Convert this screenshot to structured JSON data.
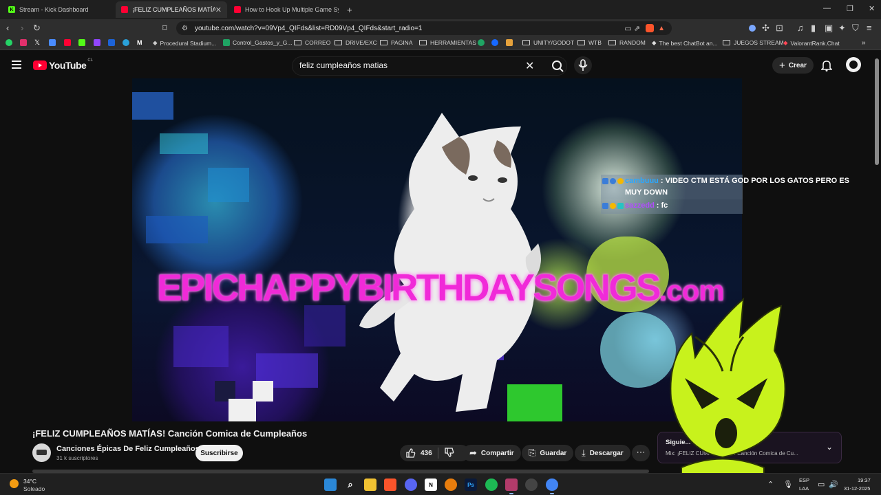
{
  "browser": {
    "tabs": [
      {
        "label": "Stream - Kick Dashboard",
        "icon": "kick-icon",
        "color": "#53fc18"
      },
      {
        "label": "¡FELIZ CUMPLEAÑOS MATÍAS! C",
        "icon": "youtube-icon",
        "color": "#ff0033"
      },
      {
        "label": "How to Hook Up Multiple Game Syst",
        "icon": "youtube-icon",
        "color": "#ff0033"
      }
    ],
    "url": "youtube.com/watch?v=09Vp4_QIFds&list=RD09Vp4_QIFds&start_radio=1",
    "bookmarks": [
      {
        "label": "Procedural Stadium..."
      },
      {
        "label": "Control_Gastos_y_G..."
      },
      {
        "label": "CORREO"
      },
      {
        "label": "DRIVE/EXC"
      },
      {
        "label": "PAGINA"
      },
      {
        "label": "HERRAMIENTAS"
      },
      {
        "label": "UNITY/GODOT"
      },
      {
        "label": "WTB"
      },
      {
        "label": "RANDOM"
      },
      {
        "label": "The best ChatBot an..."
      },
      {
        "label": "JUEGOS STREAM"
      },
      {
        "label": "ValorantRank.Chat"
      }
    ]
  },
  "youtube": {
    "logo_text": "YouTube",
    "region": "CL",
    "search_value": "feliz cumpleaños matias",
    "create_label": "Crear"
  },
  "video": {
    "overlay_text": "EPICHAPPYBIRTHDAYSONGS",
    "overlay_suffix": ".com",
    "title": "¡FELIZ CUMPLEAÑOS MATÍAS! Canción Comica de Cumpleaños",
    "channel": "Canciones Épicas De Feliz Cumpleaños",
    "subscribers": "31 k suscriptores",
    "subscribe_label": "Suscribirse",
    "likes": "436",
    "share_label": "Compartir",
    "save_label": "Guardar",
    "download_label": "Descargar"
  },
  "chat": [
    {
      "user": "cambuuu",
      "user_color": "#2aa8ff",
      "message": ": VIDEO CTM ESTÁ GOD POR LOS GATOS PERO ES MUY DOWN"
    },
    {
      "user": "sazzedd",
      "user_color": "#b24bff",
      "message": ": fc"
    }
  ],
  "up_next": {
    "line1": "Siguie...                  \"Wish\" With Live ...",
    "line2": "Mix: ¡FELIZ CUMP...          ...TÍAS! Canción Comica de Cu..."
  },
  "taskbar": {
    "temperature": "34°C",
    "weather": "Soleado",
    "lang": "ESP",
    "layout": "LAA",
    "time": "19:37",
    "date": "31-12-2025"
  }
}
